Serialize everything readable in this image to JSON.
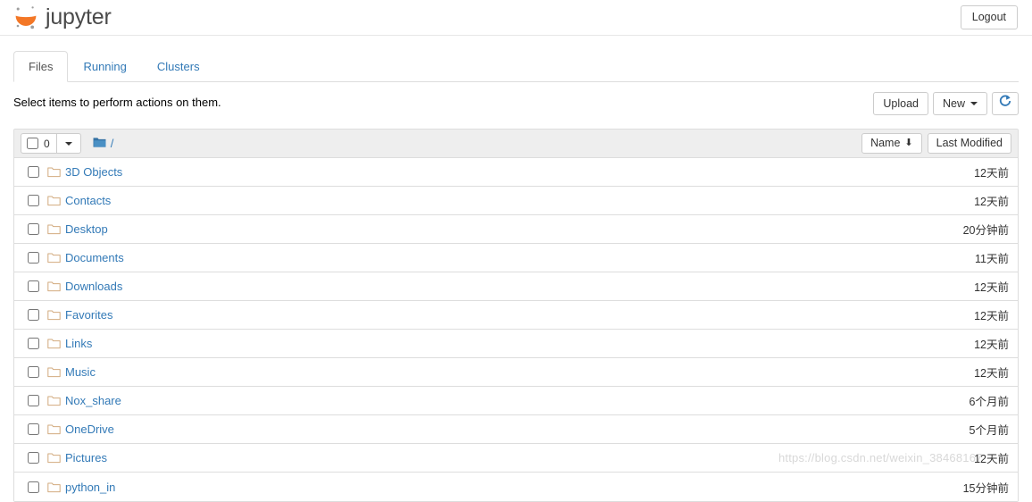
{
  "header": {
    "brand_text": "jupyter",
    "logout_label": "Logout"
  },
  "tabs": [
    {
      "label": "Files",
      "active": true
    },
    {
      "label": "Running",
      "active": false
    },
    {
      "label": "Clusters",
      "active": false
    }
  ],
  "actions": {
    "select_hint": "Select items to perform actions on them.",
    "upload_label": "Upload",
    "new_label": "New",
    "refresh_label": "⟳"
  },
  "list_header": {
    "selected_count": "0",
    "breadcrumb_root": "/",
    "sort_name_label": "Name",
    "sort_name_arrow": "⬇",
    "sort_modified_label": "Last Modified"
  },
  "files": [
    {
      "name": "3D Objects",
      "modified": "12天前",
      "type": "folder"
    },
    {
      "name": "Contacts",
      "modified": "12天前",
      "type": "folder"
    },
    {
      "name": "Desktop",
      "modified": "20分钟前",
      "type": "folder"
    },
    {
      "name": "Documents",
      "modified": "11天前",
      "type": "folder"
    },
    {
      "name": "Downloads",
      "modified": "12天前",
      "type": "folder"
    },
    {
      "name": "Favorites",
      "modified": "12天前",
      "type": "folder"
    },
    {
      "name": "Links",
      "modified": "12天前",
      "type": "folder"
    },
    {
      "name": "Music",
      "modified": "12天前",
      "type": "folder"
    },
    {
      "name": "Nox_share",
      "modified": "6个月前",
      "type": "folder"
    },
    {
      "name": "OneDrive",
      "modified": "5个月前",
      "type": "folder"
    },
    {
      "name": "Pictures",
      "modified": "12天前",
      "type": "folder"
    },
    {
      "name": "python_in",
      "modified": "15分钟前",
      "type": "folder"
    }
  ],
  "watermark": "https://blog.csdn.net/weixin_38468167",
  "colors": {
    "link": "#337ab7",
    "brand_orange": "#f37726",
    "folder_outline": "#d9b08c",
    "folder_blue": "#3572a5",
    "header_bg": "#eeeeee",
    "border": "#dddddd"
  }
}
